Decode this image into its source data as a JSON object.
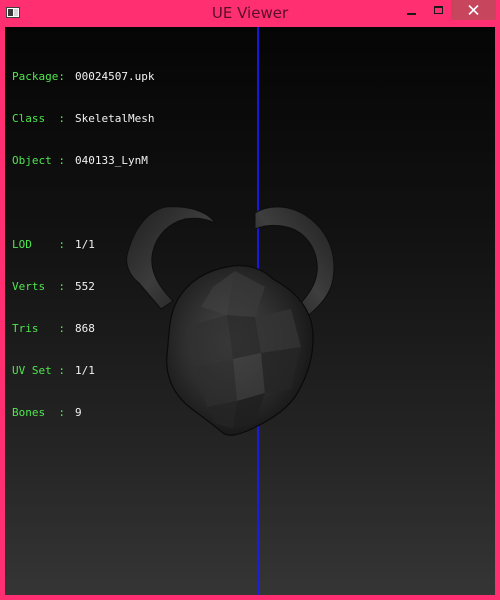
{
  "window": {
    "title": "UE Viewer",
    "controls": {
      "minimize_icon": "minimize-icon",
      "maximize_icon": "maximize-icon",
      "close_icon": "close-icon"
    },
    "accent_color": "#ff2f72"
  },
  "info": {
    "package": {
      "label": "Package:",
      "value": "00024507.upk"
    },
    "class": {
      "label": "Class  :",
      "value": "SkeletalMesh"
    },
    "object": {
      "label": "Object :",
      "value": "040133_LynM"
    },
    "lod": {
      "label": "LOD    :",
      "value": "1/1"
    },
    "verts": {
      "label": "Verts  :",
      "value": "552"
    },
    "tris": {
      "label": "Tris   :",
      "value": "868"
    },
    "uvset": {
      "label": "UV Set :",
      "value": "1/1"
    },
    "bones": {
      "label": "Bones  :",
      "value": "9"
    }
  },
  "viewport": {
    "label_color": "#4fe64f",
    "value_color": "#f2f2f2",
    "axis_color": "#1a1aff"
  }
}
